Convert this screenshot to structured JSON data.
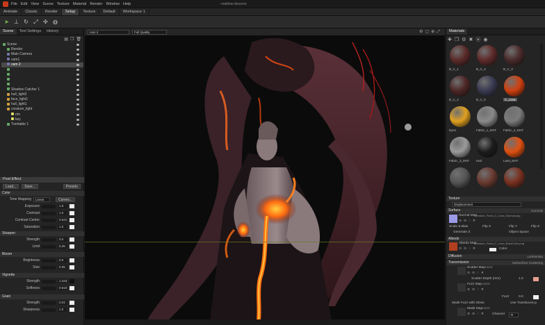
{
  "window": {
    "menu": [
      "File",
      "Edit",
      "View",
      "Scene",
      "Texture",
      "Material",
      "Render",
      "Window",
      "Help"
    ],
    "title": "- realtime.tbscene"
  },
  "workspace_tabs": [
    {
      "label": "Animate",
      "active": false
    },
    {
      "label": "Classic",
      "active": false
    },
    {
      "label": "Render",
      "active": false
    },
    {
      "label": "Setup",
      "active": true
    },
    {
      "label": "Texture",
      "active": false
    },
    {
      "label": "Default",
      "active": false
    },
    {
      "label": "Workspace 1",
      "active": false
    }
  ],
  "toolbar_icons": [
    "select-icon",
    "translate-icon",
    "rotate-icon",
    "scale-icon",
    "transform-icon",
    "globe-icon"
  ],
  "left_panel": {
    "tabs": [
      "Scene",
      "Tool Settings",
      "History"
    ],
    "tree": [
      {
        "label": "Scene",
        "icon": "obj",
        "indent": 0,
        "sel": false
      },
      {
        "label": "Render",
        "icon": "obj",
        "indent": 1,
        "sel": false
      },
      {
        "label": "Main Camera",
        "icon": "cam",
        "indent": 1,
        "sel": false
      },
      {
        "label": "cam1",
        "icon": "cam",
        "indent": 1,
        "sel": false
      },
      {
        "label": "cam 2",
        "icon": "cam",
        "indent": 1,
        "sel": true
      },
      {
        "label": "",
        "icon": "obj",
        "indent": 1,
        "sel": false
      },
      {
        "label": "",
        "icon": "obj",
        "indent": 1,
        "sel": false
      },
      {
        "label": "",
        "icon": "obj",
        "indent": 1,
        "sel": false
      },
      {
        "label": "",
        "icon": "obj",
        "indent": 1,
        "sel": false
      },
      {
        "label": "Shadow Catcher 1",
        "icon": "obj",
        "indent": 1,
        "sel": false
      },
      {
        "label": "hull_light2",
        "icon": "folder",
        "indent": 1,
        "sel": false
      },
      {
        "label": "face_light1",
        "icon": "folder",
        "indent": 1,
        "sel": false
      },
      {
        "label": "hull_light1",
        "icon": "folder",
        "indent": 1,
        "sel": false
      },
      {
        "label": "creature_light",
        "icon": "folder",
        "indent": 1,
        "sel": false
      },
      {
        "label": "rim",
        "icon": "light",
        "indent": 2,
        "sel": false
      },
      {
        "label": "key",
        "icon": "light",
        "indent": 2,
        "sel": false
      },
      {
        "label": "Turntable 1",
        "icon": "obj",
        "indent": 1,
        "sel": false
      }
    ],
    "post_effect": {
      "title": "Post Effect",
      "load": "Load...",
      "save": "Save...",
      "presets": "Presets",
      "color_section": "Color",
      "tone_mapping_label": "Tone Mapping",
      "tone_mapping_value": "Linear",
      "curves": "Curves...",
      "color_props": [
        {
          "label": "Exposure",
          "value": "1.9"
        },
        {
          "label": "Contrast",
          "value": "1.0"
        },
        {
          "label": "Contrast Center",
          "value": "0.541"
        },
        {
          "label": "Saturation",
          "value": "1.0"
        }
      ],
      "sharpen_section": "Sharpen",
      "sharpen_props": [
        {
          "label": "Strength",
          "value": "0.0"
        },
        {
          "label": "Limit",
          "value": "0.25"
        }
      ],
      "bloom_section": "Bloom",
      "bloom_props": [
        {
          "label": "Brightness",
          "value": "0.0"
        },
        {
          "label": "Size",
          "value": "0.05"
        }
      ],
      "vignette_section": "Vignette",
      "vignette_props": [
        {
          "label": "Strength",
          "value": "1.223"
        },
        {
          "label": "Softness",
          "value": "0.610"
        }
      ],
      "grain_section": "Grain",
      "grain_props": [
        {
          "label": "Strength",
          "value": "0.04"
        },
        {
          "label": "Sharpness",
          "value": "1.0"
        }
      ]
    }
  },
  "viewport": {
    "camera": "cam 2",
    "quality": "Full Quality"
  },
  "right_panel": {
    "tab": "Materials",
    "materials": [
      {
        "label": "B_C_1",
        "color": "#5a2a28",
        "sel": false
      },
      {
        "label": "B_C_2",
        "color": "#5e2a2a",
        "sel": false
      },
      {
        "label": "B_C_3",
        "color": "#4a2a2a",
        "sel": false
      },
      {
        "label": "B_C_4",
        "color": "#4e2626",
        "sel": false
      },
      {
        "label": "B_C_5",
        "color": "#3a3a52",
        "sel": false
      },
      {
        "label": "C_Lava",
        "color": "#d04010",
        "sel": true
      },
      {
        "label": "Eyes",
        "color": "#e0a020",
        "sel": false
      },
      {
        "label": "Fabric_1_MAT",
        "color": "#8a8a8a",
        "sel": false
      },
      {
        "label": "Fabric_2_MAT",
        "color": "#7a7a7a",
        "sel": false
      },
      {
        "label": "Fabric_3_MAT",
        "color": "#9a9a9a",
        "sel": false
      },
      {
        "label": "Hair",
        "color": "#1c1c1c",
        "sel": false
      },
      {
        "label": "Lava_MAT",
        "color": "#e05010",
        "sel": false
      },
      {
        "label": "",
        "color": "#555555",
        "sel": false
      },
      {
        "label": "",
        "color": "#6a3a30",
        "sel": false
      },
      {
        "label": "",
        "color": "#7a3020",
        "sel": false
      }
    ],
    "texture_section": "Texture",
    "texture_value": "Displacement",
    "surface_section": "Surface",
    "surface_mode": "Normals",
    "normal_map_label": "Normal Map",
    "normal_map_file": "Creature_Fixed_C_Lava_Normal.png",
    "flip_x": "Flip X",
    "flip_y": "Flip Y",
    "flip_z": "Flip Z",
    "scale_bias": "Scale & Bias",
    "generate_z": "Generate Z",
    "object_space": "Object Space",
    "albedo_section": "Albedo",
    "albedo_map_label": "Albedo Map",
    "albedo_map_file": "Creature_Fixed_C_Lava_BaseColor.png",
    "color_label": "Color",
    "diffusion_section": "Diffusion",
    "diffusion_mode": "Lambertian",
    "transmission_section": "Transmission",
    "transmission_mode": "Subsurface Scattering",
    "scatter_map_label": "Scatter Map",
    "scatter_map_value": "none",
    "scatter_depth_label": "Scatter Depth (mm)",
    "scatter_depth_value": "1.0",
    "fuzz_map_label": "Fuzz Map",
    "fuzz_map_value": "none",
    "fuzz_label": "Fuzz",
    "fuzz_value": "0.0",
    "mask_fuzz": "Mask Fuzz with Gloss",
    "use_translucency": "Use Translucency",
    "mask_map_label": "Mask Map",
    "mask_map_value": "none",
    "channel_label": "Channel",
    "channel_value": "R"
  }
}
